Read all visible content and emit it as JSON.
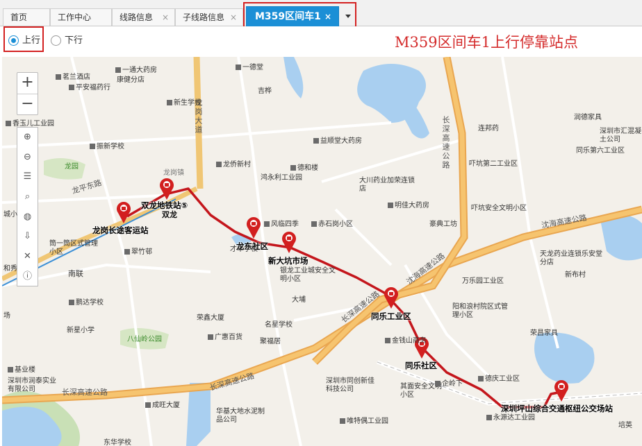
{
  "tabs": [
    {
      "label": "首页",
      "closable": false
    },
    {
      "label": "工作中心",
      "closable": false
    },
    {
      "label": "线路信息",
      "closable": true
    },
    {
      "label": "子线路信息",
      "closable": true
    },
    {
      "label": "M359区间车1",
      "closable": true,
      "active": true
    }
  ],
  "close_glyph": "×",
  "direction": {
    "options": [
      "上行",
      "下行"
    ],
    "selected": "上行"
  },
  "heading": "M359区间车1上行停靠站点",
  "zoom": {
    "in": "+",
    "out": "−"
  },
  "tools": [
    "zoom-in-icon",
    "zoom-out-icon",
    "list-icon",
    "search-icon",
    "globe-icon",
    "export-icon",
    "trash-icon",
    "info-icon"
  ],
  "stops": [
    "龙岗长途客运站",
    "双龙地铁站⑤",
    "龙东社区",
    "新大坑市场",
    "同乐工业区",
    "同乐社区",
    "深圳坪山综合交通枢纽公交场站"
  ],
  "map_labels": {
    "places": [
      "茗兰酒店",
      "平安福药行",
      "一通大药房",
      "康健分店",
      "一德堂",
      "吉桦",
      "新生学校",
      "香玉儿工业园",
      "振新学校",
      "龙园",
      "龙岗镇",
      "双龙",
      "龙侨新村",
      "益顺堂大药房",
      "德和楼",
      "鸿永利工业园",
      "大川药业加荣连锁店",
      "明佳大药房",
      "风临四季",
      "赤石岗小区",
      "连邦药",
      "吓坑第二工业区",
      "吓坑安全文明小区",
      "豪典工坊",
      "润德家具",
      "深圳市汇混凝土公司",
      "同乐第六工业区",
      "筒一筒区式管理小区",
      "南联",
      "翠竹邨",
      "才华学校",
      "银龙工业城安全文明小区",
      "天龙药业连锁乐安堂分店",
      "新布村",
      "万乐园工业区",
      "阳和浪村院区式管理小区",
      "大埔",
      "鹏达学校",
      "荣鑫大厦",
      "名星学校",
      "新星小学",
      "八仙岭公园",
      "广惠百货",
      "聚福居",
      "金钱山商务",
      "荣昌家具",
      "基业楼",
      "深圳市润泰实业有限公司",
      "深圳市同创新佳科技公司",
      "其面安全文明小区",
      "企岭下",
      "德庆工业区",
      "永源达工业园",
      "成旺大厦",
      "华基大地水泥制品公司",
      "唯特偶工业园",
      "培英",
      "东华学校",
      "城小",
      "和秀",
      "场"
    ],
    "roads": [
      "龙岗大道",
      "龙平东路",
      "长深高速公路",
      "沈海高速公路"
    ]
  },
  "colors": {
    "accent": "#1b8fd6",
    "heading": "#d42b2b",
    "route": "#c4161c",
    "highway": "#f0b35a"
  }
}
